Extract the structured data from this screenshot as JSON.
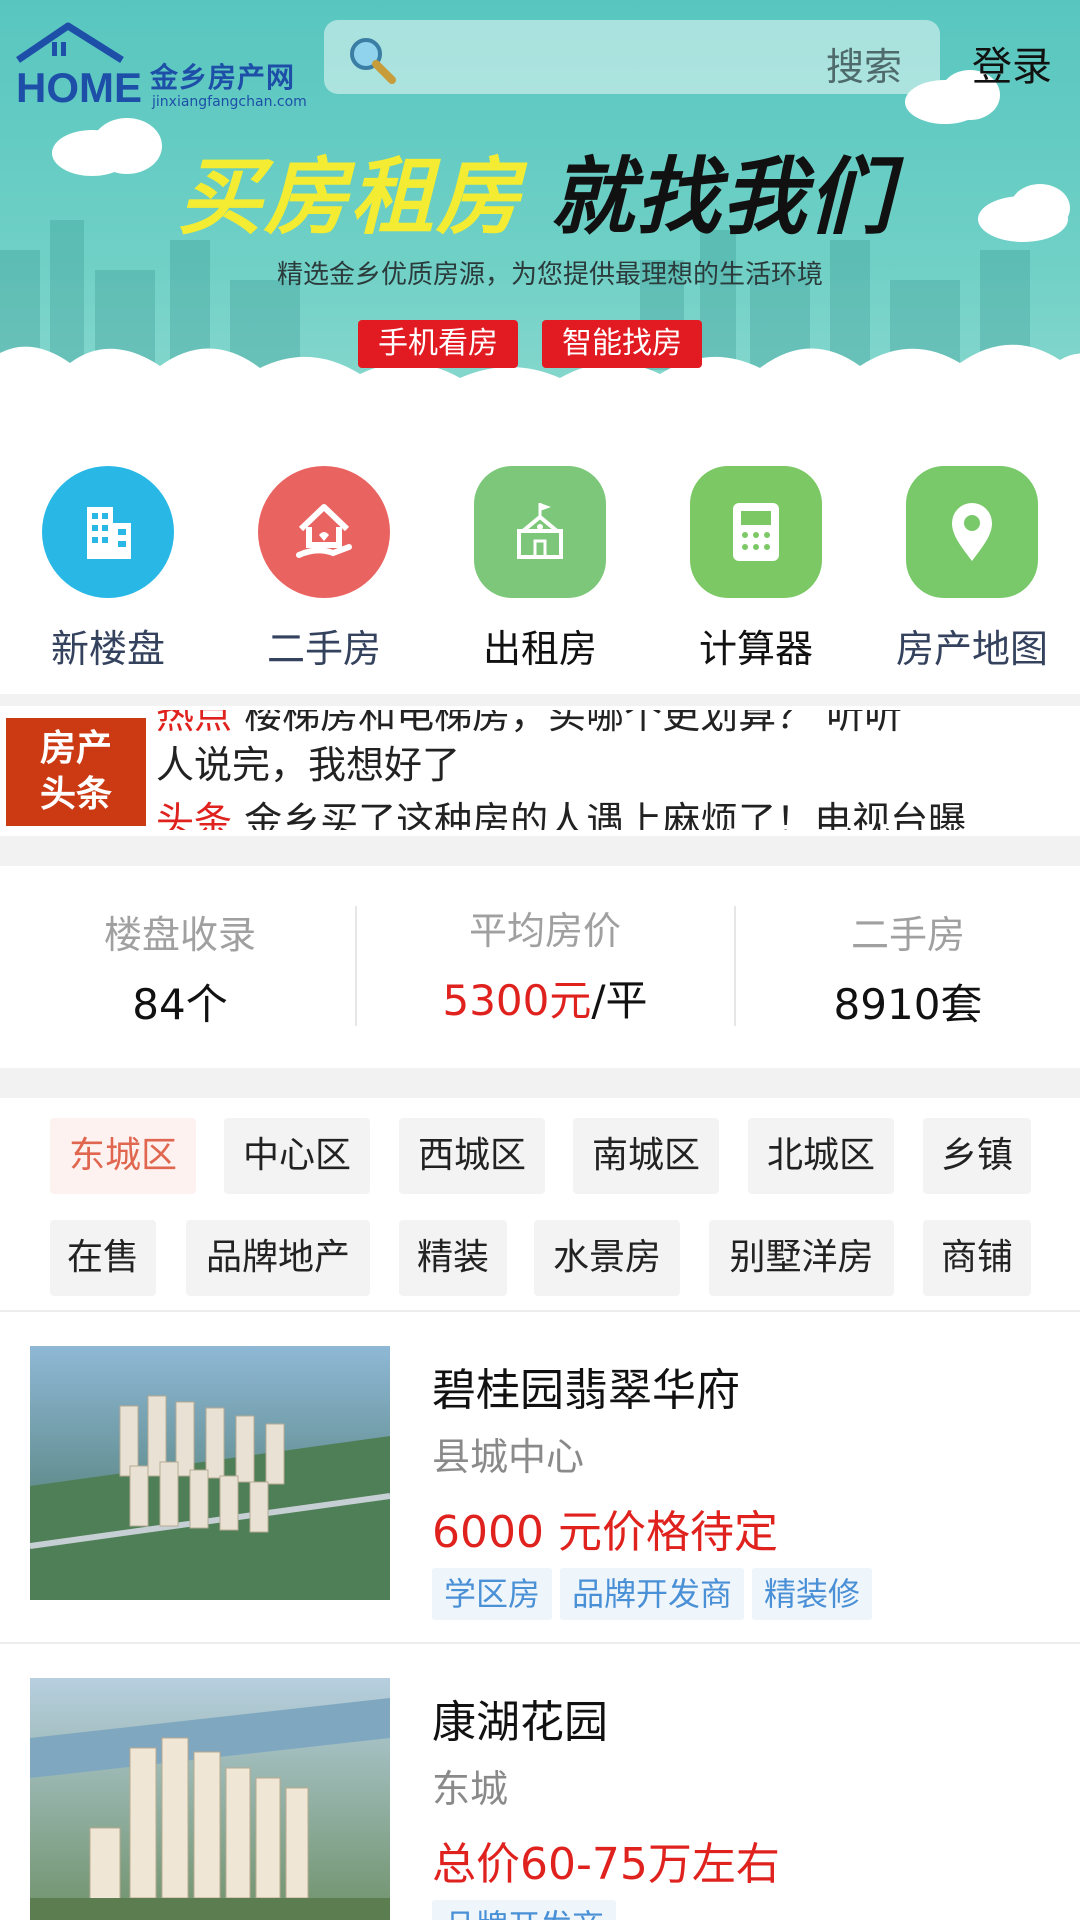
{
  "header": {
    "logo_text_cn": "金乡房产网",
    "logo_text_en": "jinxiangfangchan.com",
    "search_placeholder": "搜索",
    "login_label": "登录"
  },
  "banner": {
    "slogan_left": "买房租房",
    "slogan_right": "就找我们",
    "tagline": "精选金乡优质房源，为您提供最理想的生活环境",
    "button_1": "手机看房",
    "button_2": "智能找房"
  },
  "quick_nav": [
    {
      "label": "新楼盘",
      "icon": "building-icon",
      "color": "#29b8e6"
    },
    {
      "label": "二手房",
      "icon": "house-hand-icon",
      "color": "#e96461"
    },
    {
      "label": "出租房",
      "icon": "school-building-icon",
      "color": "#7cc77a"
    },
    {
      "label": "计算器",
      "icon": "calculator-icon",
      "color": "#7cc865"
    },
    {
      "label": "房产地图",
      "icon": "map-pin-icon",
      "color": "#79c86a"
    }
  ],
  "headlines": {
    "badge_line1": "房产",
    "badge_line2": "头条",
    "items": [
      {
        "tag": "热点",
        "text": "楼梯房和电梯房，买哪个更划算？ 听听",
        "tag_color": "#e0221e"
      },
      {
        "tag": "",
        "text": "人说完，我想好了"
      },
      {
        "tag": "头条",
        "text": "金乡买了这种房的人遇上麻烦了！电视台曝",
        "tag_color": "#e0221e"
      }
    ]
  },
  "stats": [
    {
      "label": "楼盘收录",
      "value": "84个"
    },
    {
      "label": "平均房价",
      "value_red": "5300元",
      "value_suffix": "/平"
    },
    {
      "label": "二手房",
      "value": "8910套"
    }
  ],
  "filters": {
    "row1": [
      "东城区",
      "中心区",
      "西城区",
      "南城区",
      "北城区",
      "乡镇"
    ],
    "row2": [
      "在售",
      "品牌地产",
      "精装",
      "水景房",
      "别墅洋房",
      "商铺"
    ],
    "active": "东城区"
  },
  "listings": [
    {
      "name": "碧桂园翡翠华府",
      "area": "县城中心",
      "price": "6000 元价格待定",
      "tags": [
        "学区房",
        "品牌开发商",
        "精装修"
      ]
    },
    {
      "name": "康湖花园",
      "area": "东城",
      "price": "总价60-75万左右",
      "tags": [
        "品牌开发商"
      ]
    }
  ]
}
